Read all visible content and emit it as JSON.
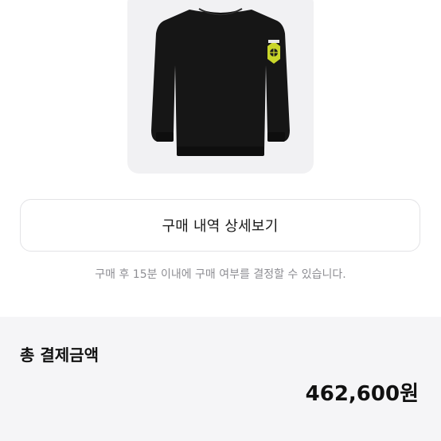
{
  "product": {
    "image_icon": "black-crewneck-sweater-with-badge"
  },
  "detail_button": {
    "label": "구매 내역 상세보기"
  },
  "notice": {
    "text": "구매 후 15분 이내에 구매 여부를 결정할 수 있습니다."
  },
  "payment": {
    "title": "총 결제금액",
    "amount": "462,600원"
  },
  "colors": {
    "card_bg": "#f1f1f3",
    "section_bg": "#f5f5f7",
    "notice_text": "#8e8e93",
    "sweater": "#161616",
    "badge": "#c9d62a"
  }
}
